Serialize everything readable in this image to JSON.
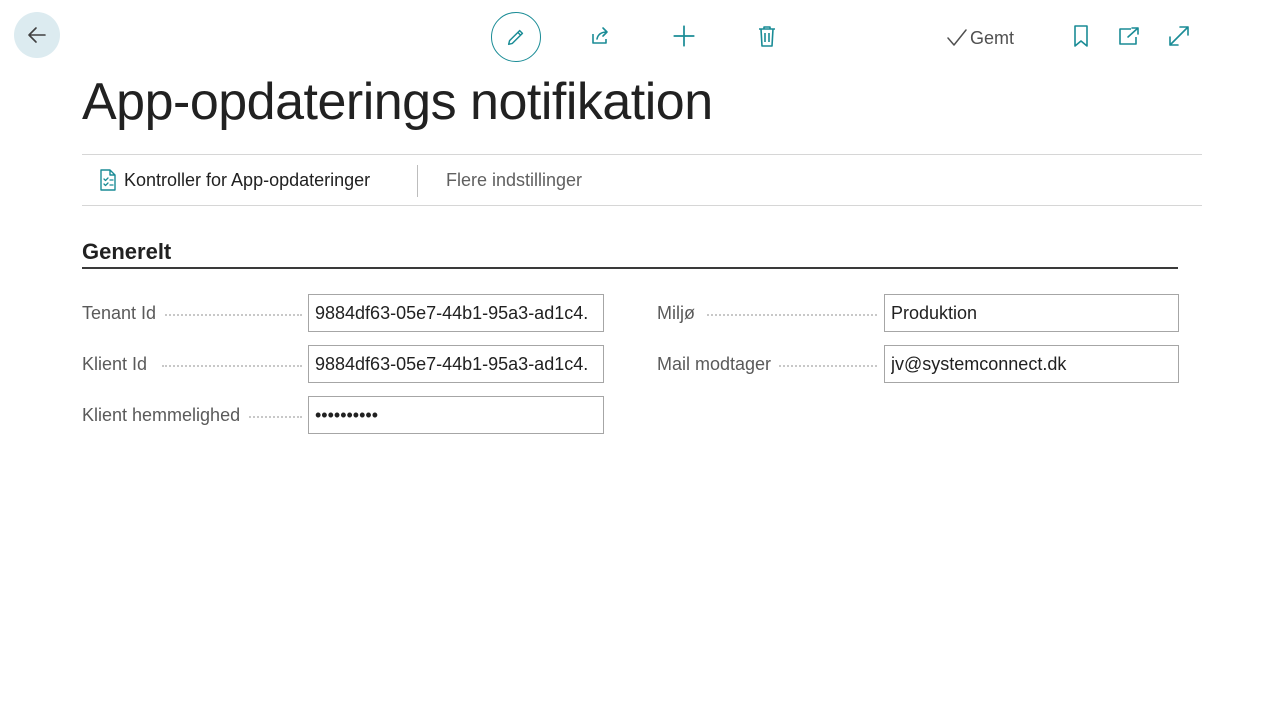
{
  "toolbar": {
    "back_icon": "arrow-left-icon",
    "edit_icon": "pencil-icon",
    "share_icon": "share-icon",
    "new_icon": "plus-icon",
    "delete_icon": "trash-icon",
    "saved_label": "Gemt",
    "saved_icon": "checkmark-icon",
    "bookmark_icon": "bookmark-icon",
    "open_new_window_icon": "open-in-new-window-icon",
    "expand_icon": "expand-icon",
    "accent_color": "#1a8c96"
  },
  "page": {
    "title": "App-opdaterings notifikation"
  },
  "actions": {
    "check_updates_label": "Kontroller for App-opdateringer",
    "check_updates_icon": "checklist-document-icon",
    "more_settings_label": "Flere indstillinger"
  },
  "section": {
    "title": "Generelt",
    "fields": {
      "tenant_id": {
        "label": "Tenant Id",
        "value": "9884df63-05e7-44b1-95a3-ad1c4."
      },
      "client_id": {
        "label": "Klient Id",
        "value": "9884df63-05e7-44b1-95a3-ad1c4."
      },
      "client_secret": {
        "label": "Klient hemmelighed",
        "value": "••••••••••"
      },
      "environment": {
        "label": "Miljø",
        "value": "Produktion"
      },
      "mail_recipient": {
        "label": "Mail modtager",
        "value": "jv@systemconnect.dk"
      }
    }
  }
}
